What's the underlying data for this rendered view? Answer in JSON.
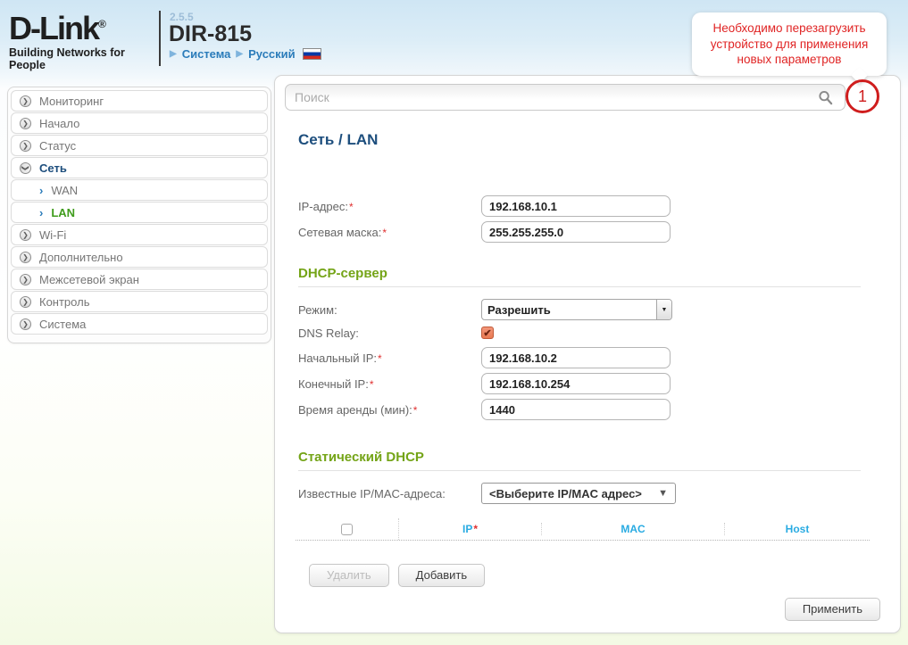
{
  "header": {
    "logo_title": "D-Link",
    "logo_reg": "®",
    "logo_tagline": "Building Networks for People",
    "firmware_version": "2.5.5",
    "model": "DIR-815",
    "breadcrumb": [
      "Система",
      "Русский"
    ],
    "breadcrumb_arrow": "▶",
    "flag": "russia-flag"
  },
  "notification": {
    "text": "Необходимо перезагрузить устройство для применения новых параметров",
    "badge_count": "1"
  },
  "sidebar": {
    "items": [
      {
        "label": "Мониторинг"
      },
      {
        "label": "Начало"
      },
      {
        "label": "Статус"
      },
      {
        "label": "Сеть",
        "expanded": true
      },
      {
        "label": "WAN",
        "parent": "Сеть"
      },
      {
        "label": "LAN",
        "parent": "Сеть",
        "active": true
      },
      {
        "label": "Wi-Fi"
      },
      {
        "label": "Дополнительно"
      },
      {
        "label": "Межсетевой экран"
      },
      {
        "label": "Контроль"
      },
      {
        "label": "Система"
      }
    ],
    "chevron_glyph": "❯",
    "sub_arrow_glyph": "›"
  },
  "search": {
    "placeholder": "Поиск"
  },
  "page": {
    "title": "Сеть /  LAN",
    "required_mark": "*",
    "lan": {
      "ip_label": "IP-адрес:",
      "ip_value": "192.168.10.1",
      "mask_label": "Сетевая маска:",
      "mask_value": "255.255.255.0"
    },
    "dhcp": {
      "heading": "DHCP-сервер",
      "mode_label": "Режим:",
      "mode_value": "Разрешить",
      "dns_relay_label": "DNS Relay:",
      "dns_relay_checked": true,
      "dns_check_glyph": "✔",
      "start_ip_label": "Начальный IP:",
      "start_ip_value": "192.168.10.2",
      "end_ip_label": "Конечный IP:",
      "end_ip_value": "192.168.10.254",
      "lease_label": "Время аренды (мин):",
      "lease_value": "1440"
    },
    "static_dhcp": {
      "heading": "Статический DHCP",
      "known_label": "Известные IP/MAC-адреса:",
      "known_value": "<Выберите IP/MAC адрес>",
      "combo_arrow": "▼",
      "table": {
        "col_ip": "IP",
        "col_mac": "MAC",
        "col_host": "Host"
      },
      "delete_button": "Удалить",
      "add_button": "Добавить"
    },
    "apply_button": "Применить"
  },
  "colors": {
    "title_navy": "#1d4e7d",
    "heading_green": "#74a417",
    "active_link_green": "#3f9c1c",
    "breadcrumb_blue": "#2b7cba",
    "table_header_blue": "#29abe2",
    "alert_red": "#cf1d1d",
    "checkbox_orange": "#e97a52"
  }
}
